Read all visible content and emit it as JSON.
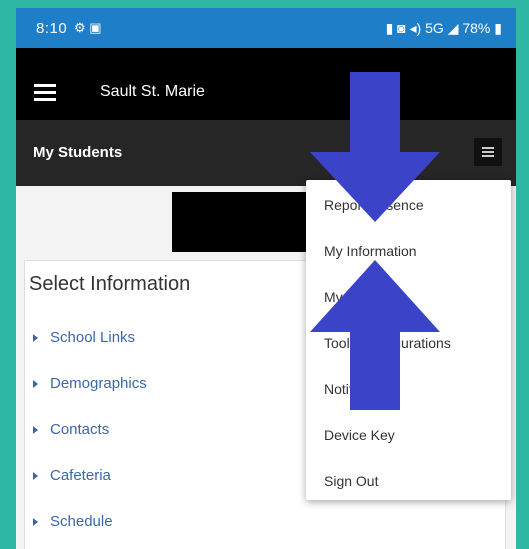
{
  "status_bar": {
    "time": "8:10",
    "left_icons": "⚙ ▣",
    "right_icons": "▮ ◙ ◂) ",
    "signal": "5G",
    "battery": "78%"
  },
  "app_bar": {
    "title": "Sault St. Marie"
  },
  "sub_bar": {
    "title": "My Students"
  },
  "card": {
    "heading": "Select Information",
    "items": [
      "School Links",
      "Demographics",
      "Contacts",
      "Cafeteria",
      "Schedule"
    ]
  },
  "menu": {
    "items": [
      "Report Absence",
      "My Information",
      "My Account",
      "Tools Configurations",
      "Notifications",
      "Device Key",
      "Sign Out"
    ]
  },
  "annotation": {
    "arrow_color": "#3b43c9"
  }
}
